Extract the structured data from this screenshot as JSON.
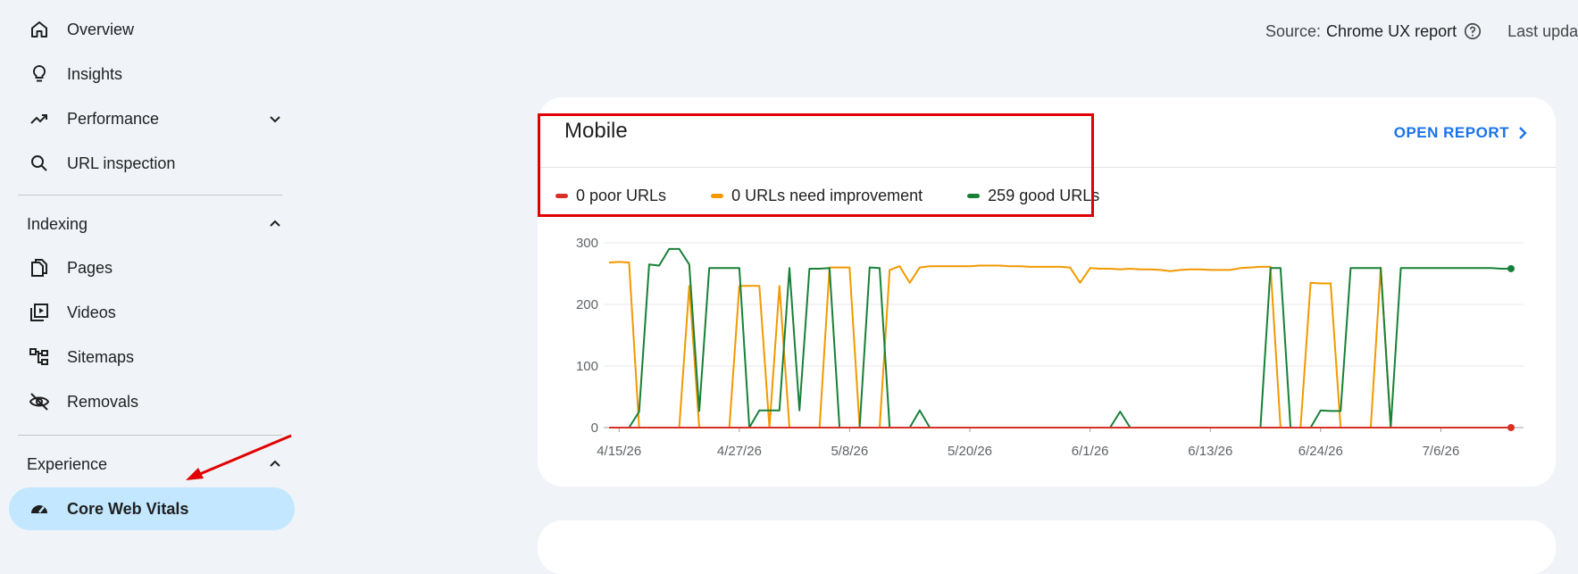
{
  "sidebar": {
    "items": [
      {
        "label": "Overview",
        "icon": "home-icon"
      },
      {
        "label": "Insights",
        "icon": "lightbulb-icon"
      },
      {
        "label": "Performance",
        "icon": "trending-up-icon"
      },
      {
        "label": "URL inspection",
        "icon": "search-icon"
      }
    ],
    "indexing": {
      "title": "Indexing",
      "items": [
        {
          "label": "Pages",
          "icon": "pages-icon"
        },
        {
          "label": "Videos",
          "icon": "videos-icon"
        },
        {
          "label": "Sitemaps",
          "icon": "sitemaps-icon"
        },
        {
          "label": "Removals",
          "icon": "visibility-off-icon"
        }
      ]
    },
    "experience": {
      "title": "Experience",
      "items": [
        {
          "label": "Core Web Vitals",
          "icon": "speed-gauge-icon",
          "active": true
        }
      ]
    }
  },
  "header": {
    "source_label": "Source:",
    "source_value": "Chrome UX report",
    "last_updated": "Last upda"
  },
  "card": {
    "title": "Mobile",
    "open_report": "OPEN REPORT",
    "legend": [
      {
        "label": "0 poor URLs",
        "color": "#d93025"
      },
      {
        "label": "0 URLs need improvement",
        "color": "#f29900"
      },
      {
        "label": "259 good URLs",
        "color": "#188038"
      }
    ]
  },
  "chart_data": {
    "type": "line",
    "xlabel": "",
    "ylabel": "",
    "ylim": [
      0,
      300
    ],
    "yticks": [
      0,
      100,
      200,
      300
    ],
    "x_tick_labels": [
      "4/15/26",
      "4/27/26",
      "5/8/26",
      "5/20/26",
      "6/1/26",
      "6/13/26",
      "6/24/26",
      "7/6/26"
    ],
    "x_tick_index": [
      1,
      13,
      24,
      36,
      48,
      60,
      71,
      83
    ],
    "grid": true,
    "series": [
      {
        "name": "0 poor URLs",
        "color": "#d93025",
        "values": [
          0,
          0,
          0,
          0,
          0,
          0,
          0,
          0,
          0,
          0,
          0,
          0,
          0,
          0,
          0,
          0,
          0,
          0,
          0,
          0,
          0,
          0,
          0,
          0,
          0,
          0,
          0,
          0,
          0,
          0,
          0,
          0,
          0,
          0,
          0,
          0,
          0,
          0,
          0,
          0,
          0,
          0,
          0,
          0,
          0,
          0,
          0,
          0,
          0,
          0,
          0,
          0,
          0,
          0,
          0,
          0,
          0,
          0,
          0,
          0,
          0,
          0,
          0,
          0,
          0,
          0,
          0,
          0,
          0,
          0,
          0,
          0,
          0,
          0,
          0,
          0,
          0,
          0,
          0,
          0,
          0,
          0,
          0,
          0,
          0,
          0,
          0,
          0,
          0,
          0,
          0
        ]
      },
      {
        "name": "0 URLs need improvement",
        "color": "#f29900",
        "values": [
          268,
          269,
          268,
          0,
          0,
          0,
          0,
          0,
          230,
          0,
          0,
          0,
          0,
          230,
          230,
          230,
          0,
          230,
          0,
          0,
          0,
          0,
          260,
          260,
          260,
          0,
          0,
          0,
          256,
          262,
          235,
          260,
          262,
          262,
          262,
          262,
          262,
          263,
          263,
          263,
          262,
          262,
          261,
          261,
          261,
          261,
          260,
          235,
          259,
          258,
          258,
          257,
          258,
          257,
          257,
          256,
          254,
          256,
          257,
          257,
          256,
          256,
          256,
          259,
          260,
          261,
          261,
          0,
          0,
          0,
          235,
          234,
          234,
          0,
          0,
          0,
          0,
          260,
          0,
          0,
          0,
          0,
          0,
          0,
          0,
          0,
          0,
          0,
          0,
          0,
          0
        ]
      },
      {
        "name": "259 good URLs",
        "color": "#188038",
        "values": [
          0,
          0,
          0,
          26,
          265,
          263,
          290,
          290,
          265,
          27,
          259,
          259,
          259,
          259,
          0,
          28,
          28,
          28,
          259,
          28,
          258,
          258,
          259,
          0,
          0,
          0,
          260,
          259,
          0,
          0,
          0,
          28,
          0,
          0,
          0,
          0,
          0,
          0,
          0,
          0,
          0,
          0,
          0,
          0,
          0,
          0,
          0,
          0,
          0,
          0,
          0,
          26,
          0,
          0,
          0,
          0,
          0,
          0,
          0,
          0,
          0,
          0,
          0,
          0,
          0,
          0,
          259,
          259,
          0,
          0,
          0,
          28,
          27,
          27,
          259,
          259,
          259,
          259,
          0,
          259,
          259,
          259,
          259,
          259,
          259,
          259,
          259,
          259,
          259,
          258,
          258
        ]
      }
    ]
  }
}
